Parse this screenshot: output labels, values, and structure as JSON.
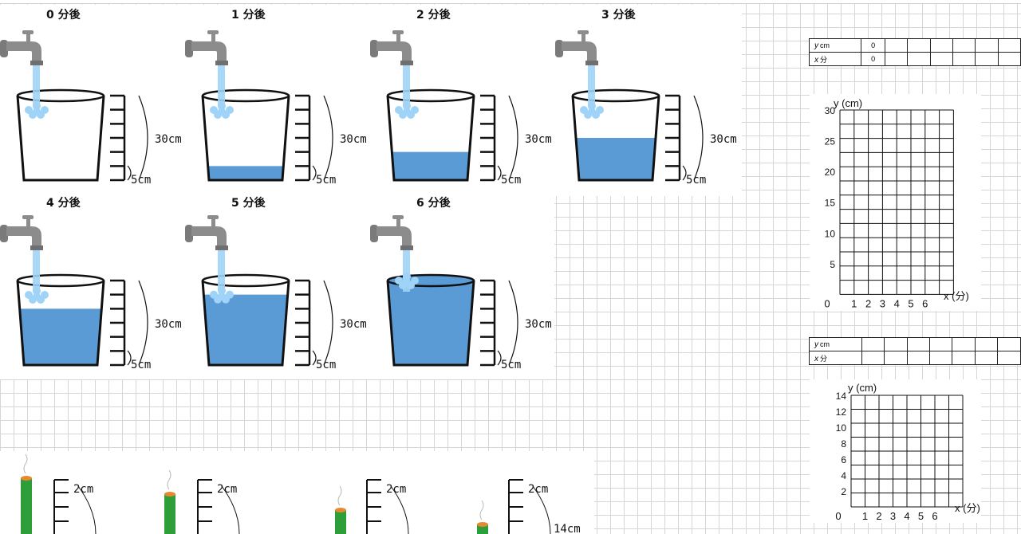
{
  "buckets": [
    {
      "label": "0 分後",
      "fill": 0
    },
    {
      "label": "1 分後",
      "fill": 5
    },
    {
      "label": "2 分後",
      "fill": 10
    },
    {
      "label": "3 分後",
      "fill": 15
    },
    {
      "label": "4 分後",
      "fill": 20
    },
    {
      "label": "5 分後",
      "fill": 25
    },
    {
      "label": "6 分後",
      "fill": 30
    }
  ],
  "bucket_scale": {
    "total": "30cm",
    "step": "5cm"
  },
  "colors": {
    "water": "#5b9bd5",
    "stream": "#9fd3f7",
    "faucet": "#8c8c8c"
  },
  "table1": {
    "y_var": "y",
    "y_unit": "cm",
    "x_var": "x",
    "x_unit": "分",
    "y0": "0",
    "x0": "0",
    "extra_columns": 6
  },
  "graph1": {
    "ylabel": "y (cm)",
    "xlabel": "x (分)",
    "y_ticks": [
      "30",
      "25",
      "20",
      "15",
      "10",
      "5"
    ],
    "x_ticks": [
      "0",
      "1",
      "2",
      "3",
      "4",
      "5",
      "6"
    ]
  },
  "table2": {
    "y_var": "y",
    "y_unit": "cm",
    "x_var": "x",
    "x_unit": "分",
    "extra_columns": 6
  },
  "graph2": {
    "ylabel": "y (cm)",
    "xlabel": "x (分)",
    "y_ticks": [
      "14",
      "12",
      "10",
      "8",
      "6",
      "4",
      "2"
    ],
    "x_ticks": [
      "0",
      "1",
      "2",
      "3",
      "4",
      "5",
      "6"
    ]
  },
  "candles": {
    "top_label": "2cm",
    "bottom_label": "14cm"
  }
}
